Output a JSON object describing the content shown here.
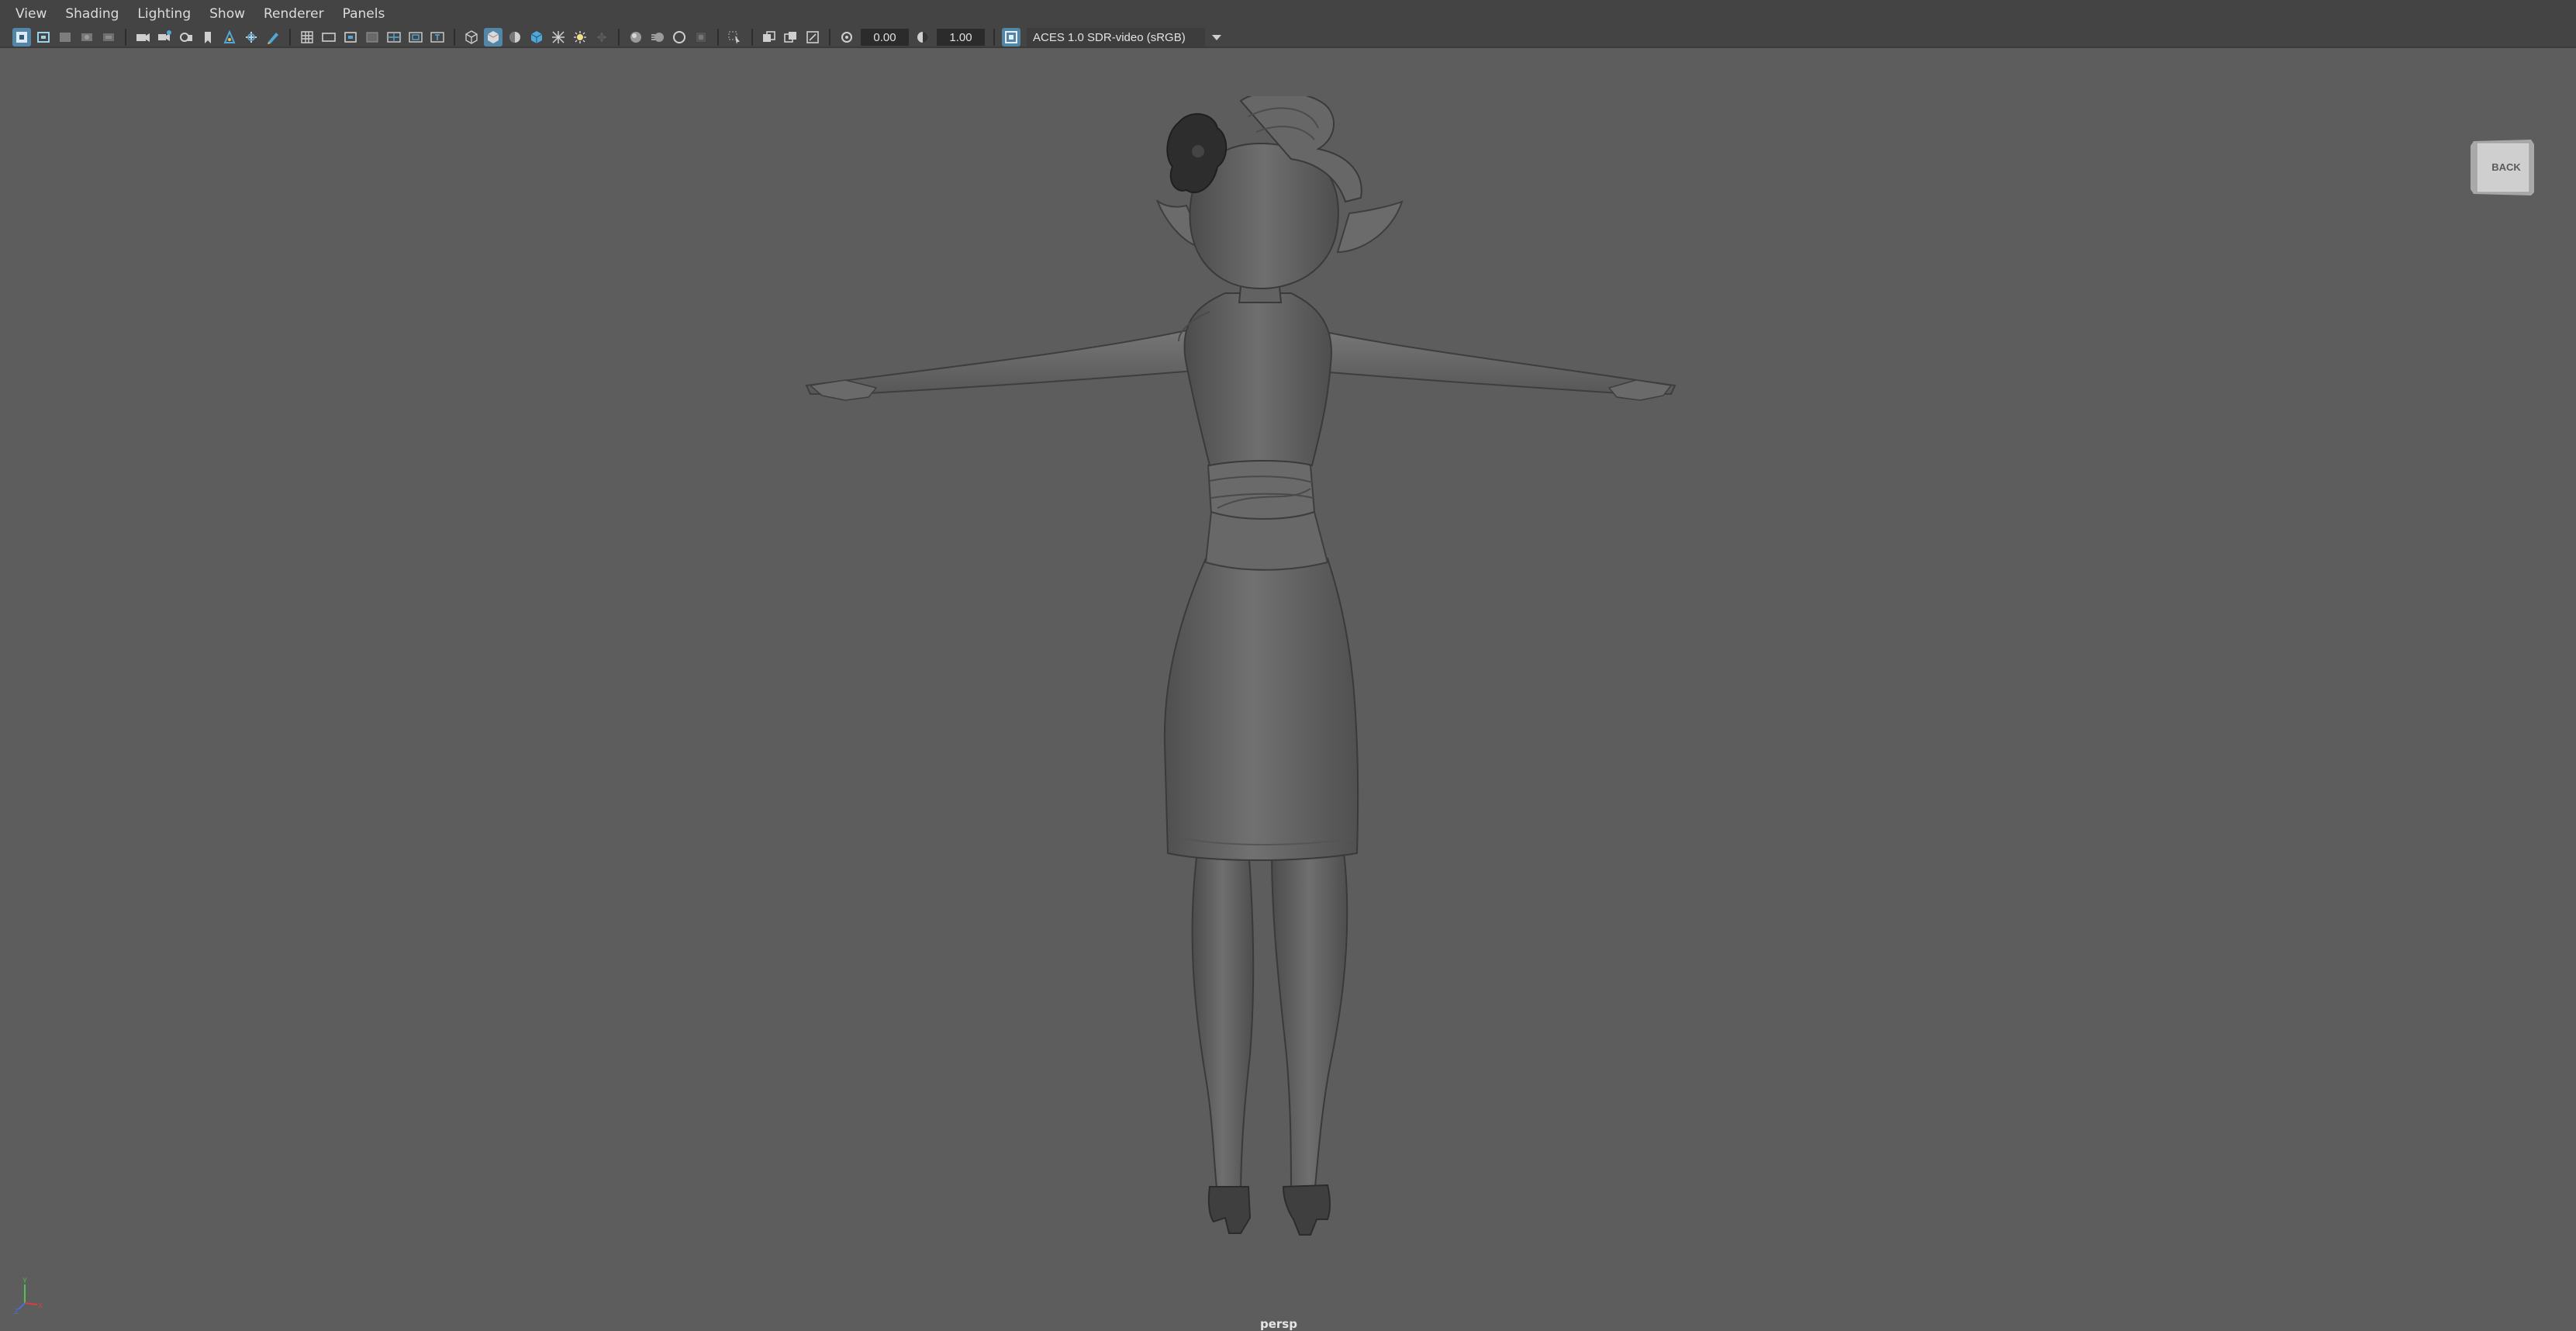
{
  "menu": {
    "items": [
      "View",
      "Shading",
      "Lighting",
      "Show",
      "Renderer",
      "Panels"
    ]
  },
  "toolbar": {
    "exposure_value": "0.00",
    "gamma_value": "1.00",
    "color_management": "ACES 1.0 SDR-video (sRGB)"
  },
  "viewcube": {
    "face_label": "BACK"
  },
  "axis": {
    "x": "X",
    "y": "Y",
    "z": "Z"
  },
  "viewport": {
    "camera_label": "persp"
  },
  "colors": {
    "ui_bar": "#444444",
    "viewport_bg": "#5d5d5d",
    "active_button": "#5285a6",
    "axis_x": "#d84040",
    "axis_y": "#52c152",
    "axis_z": "#4a6fd8"
  }
}
